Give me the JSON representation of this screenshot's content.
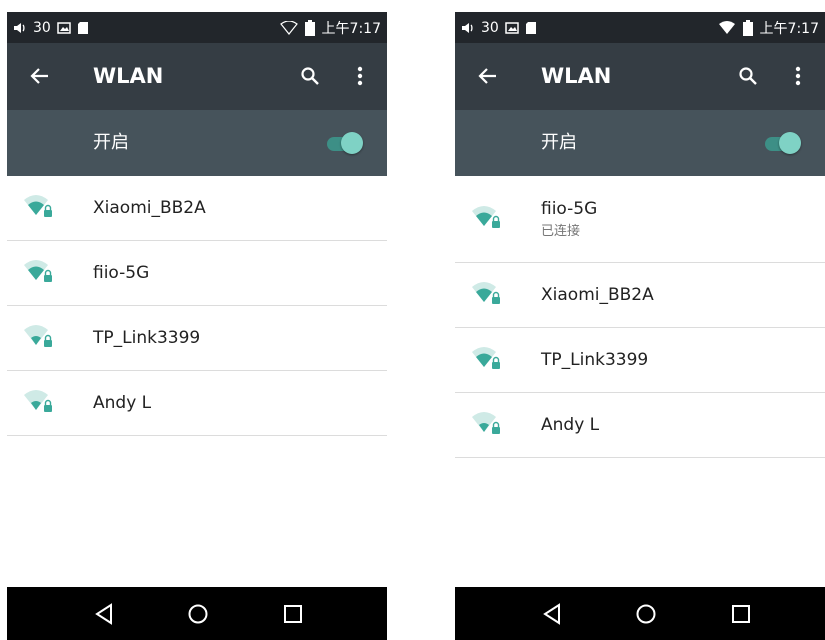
{
  "colors": {
    "status_bar": "#22262b",
    "app_bar": "#353d44",
    "toggle_bar": "#46535b",
    "accent": "#7fd2c5",
    "wifi_icon": "#3aa99a",
    "nav_bar": "#000000"
  },
  "left": {
    "status": {
      "volume_value": "30",
      "time": "上午7:17",
      "left_icons": [
        "volume-icon",
        "image-icon",
        "sd-card-icon"
      ],
      "right_icons": [
        "wifi-outline-icon",
        "battery-icon"
      ]
    },
    "app_bar": {
      "title": "WLAN"
    },
    "toggle": {
      "label": "开启",
      "on": true
    },
    "networks": [
      {
        "ssid": "Xiaomi_BB2A",
        "status": ""
      },
      {
        "ssid": "fiio-5G",
        "status": ""
      },
      {
        "ssid": "TP_Link3399",
        "status": ""
      },
      {
        "ssid": "Andy L",
        "status": ""
      }
    ]
  },
  "right": {
    "status": {
      "volume_value": "30",
      "time": "上午7:17",
      "left_icons": [
        "volume-icon",
        "image-icon",
        "sd-card-icon"
      ],
      "right_icons": [
        "wifi-filled-icon",
        "battery-icon"
      ]
    },
    "app_bar": {
      "title": "WLAN"
    },
    "toggle": {
      "label": "开启",
      "on": true
    },
    "networks": [
      {
        "ssid": "fiio-5G",
        "status": "已连接"
      },
      {
        "ssid": "Xiaomi_BB2A",
        "status": ""
      },
      {
        "ssid": "TP_Link3399",
        "status": ""
      },
      {
        "ssid": "Andy L",
        "status": ""
      }
    ]
  }
}
